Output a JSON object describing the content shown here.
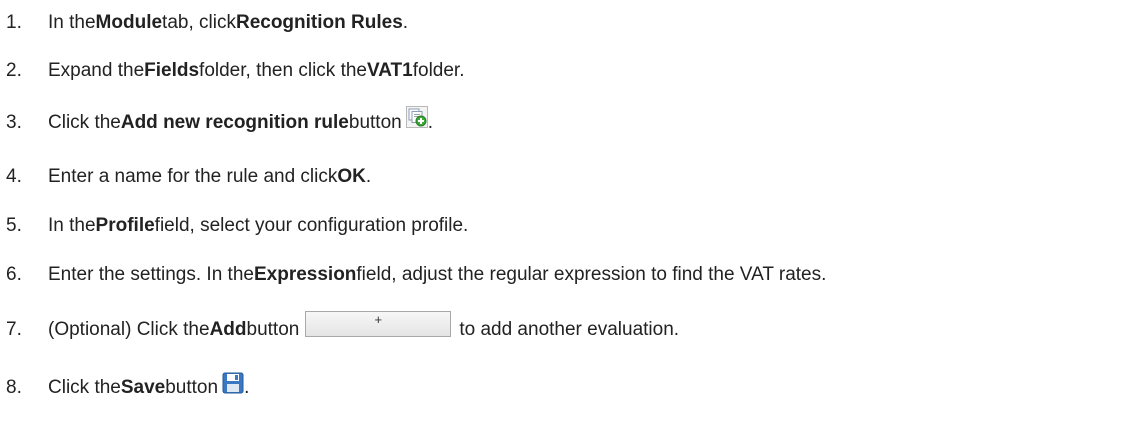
{
  "steps": [
    {
      "num": "1.",
      "parts": [
        "In the ",
        "Module",
        " tab, click ",
        "Recognition Rules",
        "."
      ]
    },
    {
      "num": "2.",
      "parts": [
        "Expand the ",
        "Fields",
        " folder, then click the ",
        "VAT1",
        " folder."
      ]
    },
    {
      "num": "3.",
      "parts": [
        "Click the ",
        "Add new recognition rule",
        " button",
        "."
      ],
      "icon": "add-recognition-rule-icon"
    },
    {
      "num": "4.",
      "parts": [
        "Enter a name for the rule and click ",
        "OK",
        "."
      ]
    },
    {
      "num": "5.",
      "parts": [
        "In the ",
        "Profile",
        " field, select your configuration profile."
      ]
    },
    {
      "num": "6.",
      "parts": [
        "Enter the settings. In the ",
        "Expression",
        " field, adjust the regular expression to find the VAT rates."
      ]
    },
    {
      "num": "7.",
      "parts": [
        "(Optional) Click the ",
        "Add",
        " button",
        "to add another evaluation."
      ],
      "button_label": "+"
    },
    {
      "num": "8.",
      "parts": [
        "Click the ",
        "Save",
        " button",
        "."
      ],
      "icon": "save-icon"
    }
  ],
  "colors": {
    "text": "#222222",
    "icon_blue": "#3a78c2",
    "icon_green": "#3aa935"
  }
}
